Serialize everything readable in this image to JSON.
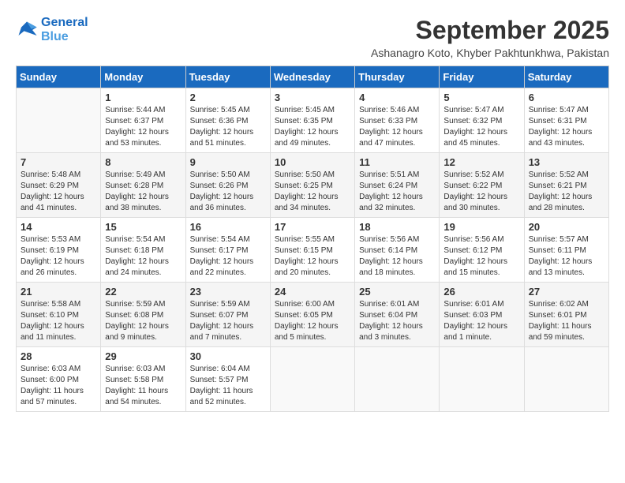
{
  "logo": {
    "line1": "General",
    "line2": "Blue"
  },
  "title": "September 2025",
  "location": "Ashanagro Koto, Khyber Pakhtunkhwa, Pakistan",
  "weekdays": [
    "Sunday",
    "Monday",
    "Tuesday",
    "Wednesday",
    "Thursday",
    "Friday",
    "Saturday"
  ],
  "weeks": [
    [
      {
        "day": "",
        "sunrise": "",
        "sunset": "",
        "daylight": "",
        "empty": true
      },
      {
        "day": "1",
        "sunrise": "Sunrise: 5:44 AM",
        "sunset": "Sunset: 6:37 PM",
        "daylight": "Daylight: 12 hours and 53 minutes."
      },
      {
        "day": "2",
        "sunrise": "Sunrise: 5:45 AM",
        "sunset": "Sunset: 6:36 PM",
        "daylight": "Daylight: 12 hours and 51 minutes."
      },
      {
        "day": "3",
        "sunrise": "Sunrise: 5:45 AM",
        "sunset": "Sunset: 6:35 PM",
        "daylight": "Daylight: 12 hours and 49 minutes."
      },
      {
        "day": "4",
        "sunrise": "Sunrise: 5:46 AM",
        "sunset": "Sunset: 6:33 PM",
        "daylight": "Daylight: 12 hours and 47 minutes."
      },
      {
        "day": "5",
        "sunrise": "Sunrise: 5:47 AM",
        "sunset": "Sunset: 6:32 PM",
        "daylight": "Daylight: 12 hours and 45 minutes."
      },
      {
        "day": "6",
        "sunrise": "Sunrise: 5:47 AM",
        "sunset": "Sunset: 6:31 PM",
        "daylight": "Daylight: 12 hours and 43 minutes."
      }
    ],
    [
      {
        "day": "7",
        "sunrise": "Sunrise: 5:48 AM",
        "sunset": "Sunset: 6:29 PM",
        "daylight": "Daylight: 12 hours and 41 minutes."
      },
      {
        "day": "8",
        "sunrise": "Sunrise: 5:49 AM",
        "sunset": "Sunset: 6:28 PM",
        "daylight": "Daylight: 12 hours and 38 minutes."
      },
      {
        "day": "9",
        "sunrise": "Sunrise: 5:50 AM",
        "sunset": "Sunset: 6:26 PM",
        "daylight": "Daylight: 12 hours and 36 minutes."
      },
      {
        "day": "10",
        "sunrise": "Sunrise: 5:50 AM",
        "sunset": "Sunset: 6:25 PM",
        "daylight": "Daylight: 12 hours and 34 minutes."
      },
      {
        "day": "11",
        "sunrise": "Sunrise: 5:51 AM",
        "sunset": "Sunset: 6:24 PM",
        "daylight": "Daylight: 12 hours and 32 minutes."
      },
      {
        "day": "12",
        "sunrise": "Sunrise: 5:52 AM",
        "sunset": "Sunset: 6:22 PM",
        "daylight": "Daylight: 12 hours and 30 minutes."
      },
      {
        "day": "13",
        "sunrise": "Sunrise: 5:52 AM",
        "sunset": "Sunset: 6:21 PM",
        "daylight": "Daylight: 12 hours and 28 minutes."
      }
    ],
    [
      {
        "day": "14",
        "sunrise": "Sunrise: 5:53 AM",
        "sunset": "Sunset: 6:19 PM",
        "daylight": "Daylight: 12 hours and 26 minutes."
      },
      {
        "day": "15",
        "sunrise": "Sunrise: 5:54 AM",
        "sunset": "Sunset: 6:18 PM",
        "daylight": "Daylight: 12 hours and 24 minutes."
      },
      {
        "day": "16",
        "sunrise": "Sunrise: 5:54 AM",
        "sunset": "Sunset: 6:17 PM",
        "daylight": "Daylight: 12 hours and 22 minutes."
      },
      {
        "day": "17",
        "sunrise": "Sunrise: 5:55 AM",
        "sunset": "Sunset: 6:15 PM",
        "daylight": "Daylight: 12 hours and 20 minutes."
      },
      {
        "day": "18",
        "sunrise": "Sunrise: 5:56 AM",
        "sunset": "Sunset: 6:14 PM",
        "daylight": "Daylight: 12 hours and 18 minutes."
      },
      {
        "day": "19",
        "sunrise": "Sunrise: 5:56 AM",
        "sunset": "Sunset: 6:12 PM",
        "daylight": "Daylight: 12 hours and 15 minutes."
      },
      {
        "day": "20",
        "sunrise": "Sunrise: 5:57 AM",
        "sunset": "Sunset: 6:11 PM",
        "daylight": "Daylight: 12 hours and 13 minutes."
      }
    ],
    [
      {
        "day": "21",
        "sunrise": "Sunrise: 5:58 AM",
        "sunset": "Sunset: 6:10 PM",
        "daylight": "Daylight: 12 hours and 11 minutes."
      },
      {
        "day": "22",
        "sunrise": "Sunrise: 5:59 AM",
        "sunset": "Sunset: 6:08 PM",
        "daylight": "Daylight: 12 hours and 9 minutes."
      },
      {
        "day": "23",
        "sunrise": "Sunrise: 5:59 AM",
        "sunset": "Sunset: 6:07 PM",
        "daylight": "Daylight: 12 hours and 7 minutes."
      },
      {
        "day": "24",
        "sunrise": "Sunrise: 6:00 AM",
        "sunset": "Sunset: 6:05 PM",
        "daylight": "Daylight: 12 hours and 5 minutes."
      },
      {
        "day": "25",
        "sunrise": "Sunrise: 6:01 AM",
        "sunset": "Sunset: 6:04 PM",
        "daylight": "Daylight: 12 hours and 3 minutes."
      },
      {
        "day": "26",
        "sunrise": "Sunrise: 6:01 AM",
        "sunset": "Sunset: 6:03 PM",
        "daylight": "Daylight: 12 hours and 1 minute."
      },
      {
        "day": "27",
        "sunrise": "Sunrise: 6:02 AM",
        "sunset": "Sunset: 6:01 PM",
        "daylight": "Daylight: 11 hours and 59 minutes."
      }
    ],
    [
      {
        "day": "28",
        "sunrise": "Sunrise: 6:03 AM",
        "sunset": "Sunset: 6:00 PM",
        "daylight": "Daylight: 11 hours and 57 minutes."
      },
      {
        "day": "29",
        "sunrise": "Sunrise: 6:03 AM",
        "sunset": "Sunset: 5:58 PM",
        "daylight": "Daylight: 11 hours and 54 minutes."
      },
      {
        "day": "30",
        "sunrise": "Sunrise: 6:04 AM",
        "sunset": "Sunset: 5:57 PM",
        "daylight": "Daylight: 11 hours and 52 minutes."
      },
      {
        "day": "",
        "sunrise": "",
        "sunset": "",
        "daylight": "",
        "empty": true
      },
      {
        "day": "",
        "sunrise": "",
        "sunset": "",
        "daylight": "",
        "empty": true
      },
      {
        "day": "",
        "sunrise": "",
        "sunset": "",
        "daylight": "",
        "empty": true
      },
      {
        "day": "",
        "sunrise": "",
        "sunset": "",
        "daylight": "",
        "empty": true
      }
    ]
  ]
}
